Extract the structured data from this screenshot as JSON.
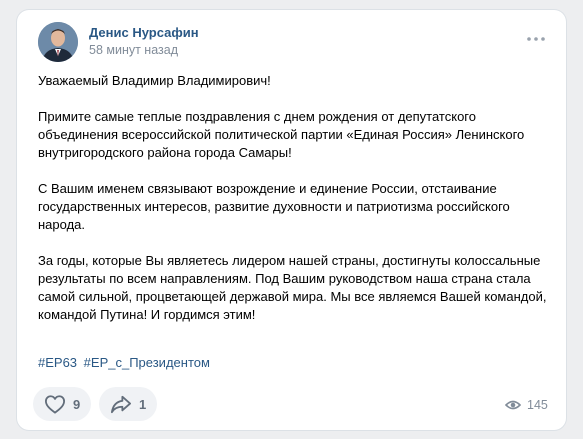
{
  "post": {
    "author": "Денис Нурсафин",
    "time": "58 минут назад",
    "paragraphs": [
      "Уважаемый Владимир Владимирович!",
      "Примите самые теплые поздравления с днем рождения от депутатского объединения всероссийской политической партии «Единая Россия» Ленинского внутригородского района города Самары!",
      "С Вашим именем связывают возрождение и единение России, отстаивание государственных интересов, развитие духовности и патриотизма российского народа.",
      "За годы, которые Вы являетесь лидером нашей страны, достигнуты колоссальные результаты по всем направлениям. Под Вашим руководством наша страна стала самой сильной, процветающей державой мира. Мы все являемся Вашей командой, командой Путина! И гордимся этим!"
    ],
    "hashtags": [
      "#ЕР63",
      "#ЕР_с_Президентом"
    ]
  },
  "actions": {
    "likes": "9",
    "shares": "1",
    "views": "145"
  },
  "icons": {
    "more": "more-horizontal-icon",
    "like": "heart-icon",
    "share": "share-arrow-icon",
    "views": "eye-icon"
  },
  "colors": {
    "link": "#2a5885",
    "muted": "#818c99",
    "background": "#edeef0"
  }
}
